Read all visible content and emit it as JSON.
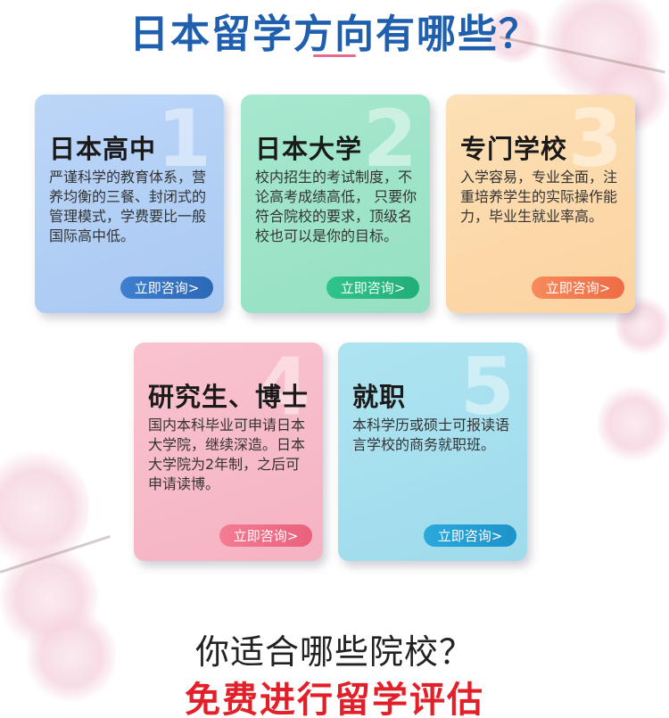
{
  "header": {
    "title": "日本留学方向有哪些？"
  },
  "cards": [
    {
      "number": "1",
      "title": "日本高中",
      "text": "严谨科学的教育体系，营养均衡的三餐、封闭式的管理模式，学费要比一般国际高中低。",
      "cta": "立即咨询>",
      "accent": "#2c68b6"
    },
    {
      "number": "2",
      "title": "日本大学",
      "text": "校内招生的考试制度，不论高考成绩高低， 只要你符合院校的要求，顶级名校也可以是你的目标。",
      "cta": "立即咨询>",
      "accent": "#22ad78"
    },
    {
      "number": "3",
      "title": "专门学校",
      "text": "入学容易，专业全面，注重培养学生的实际操作能力，毕业生就业率高。",
      "cta": "立即咨询>",
      "accent": "#ee6c45"
    },
    {
      "number": "4",
      "title": "研究生、博士",
      "text": "国内本科毕业可申请日本大学院，继续深造。日本大学院为2年制，之后可申请读博。",
      "cta": "立即咨询>",
      "accent": "#e9617c"
    },
    {
      "number": "5",
      "title": "就职",
      "text": "本科学历或硕士可报读语言学校的商务就职班。",
      "cta": "立即咨询>",
      "accent": "#1d93c9"
    }
  ],
  "footer": {
    "question": "你适合哪些院校？",
    "promo": "免费进行留学评估"
  }
}
